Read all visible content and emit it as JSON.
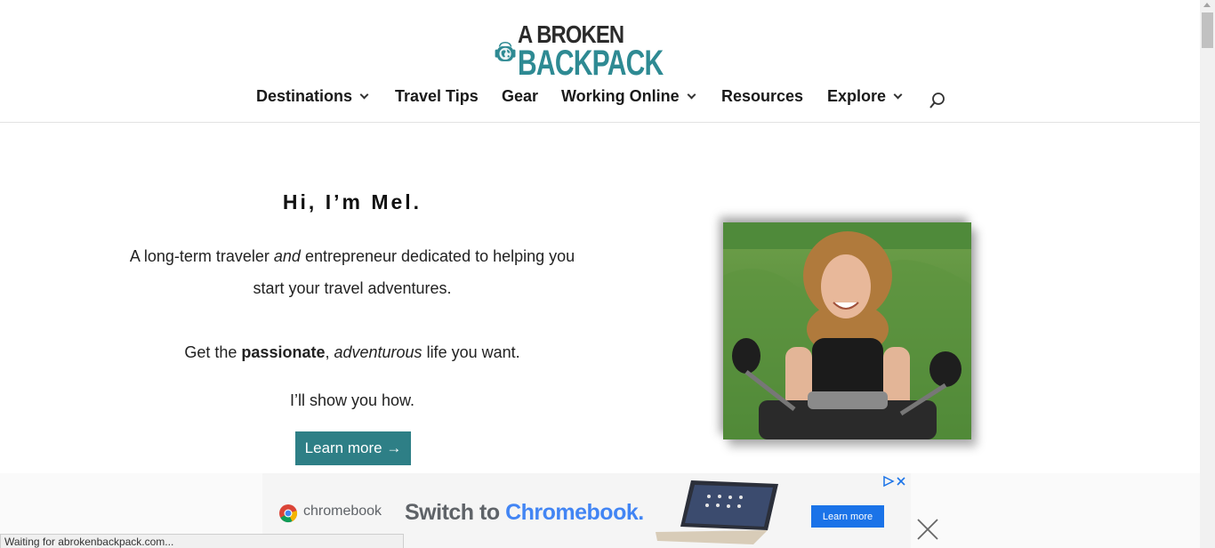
{
  "logo": {
    "line1": "A BROKEN",
    "line2": "BACKPACK",
    "brand_color": "#2e8a93"
  },
  "nav": {
    "items": [
      {
        "label": "Destinations",
        "has_dropdown": true
      },
      {
        "label": "Travel Tips",
        "has_dropdown": false
      },
      {
        "label": "Gear",
        "has_dropdown": false
      },
      {
        "label": "Working Online",
        "has_dropdown": true
      },
      {
        "label": "Resources",
        "has_dropdown": false
      },
      {
        "label": "Explore",
        "has_dropdown": true
      }
    ],
    "search_icon": "search-icon"
  },
  "hero": {
    "title": "Hi, I’m Mel.",
    "intro_before": "A long-term traveler ",
    "intro_em": "and",
    "intro_after": " entrepreneur dedicated to helping you start your travel adventures.",
    "line2_before": "Get the ",
    "line2_strong": "passionate",
    "line2_mid": ", ",
    "line2_em": "adventurous",
    "line2_after": " life you want.",
    "line3": "I’ll show you how.",
    "button_label": "Learn more →",
    "button_color": "#2e7f86"
  },
  "ad": {
    "brand": "chromebook",
    "headline_part1": "Switch to ",
    "headline_part2": "Chromebook.",
    "button_label": "Learn more",
    "accent": "#4285f4"
  },
  "status_bar": {
    "text": "Waiting for abrokenbackpack.com..."
  }
}
